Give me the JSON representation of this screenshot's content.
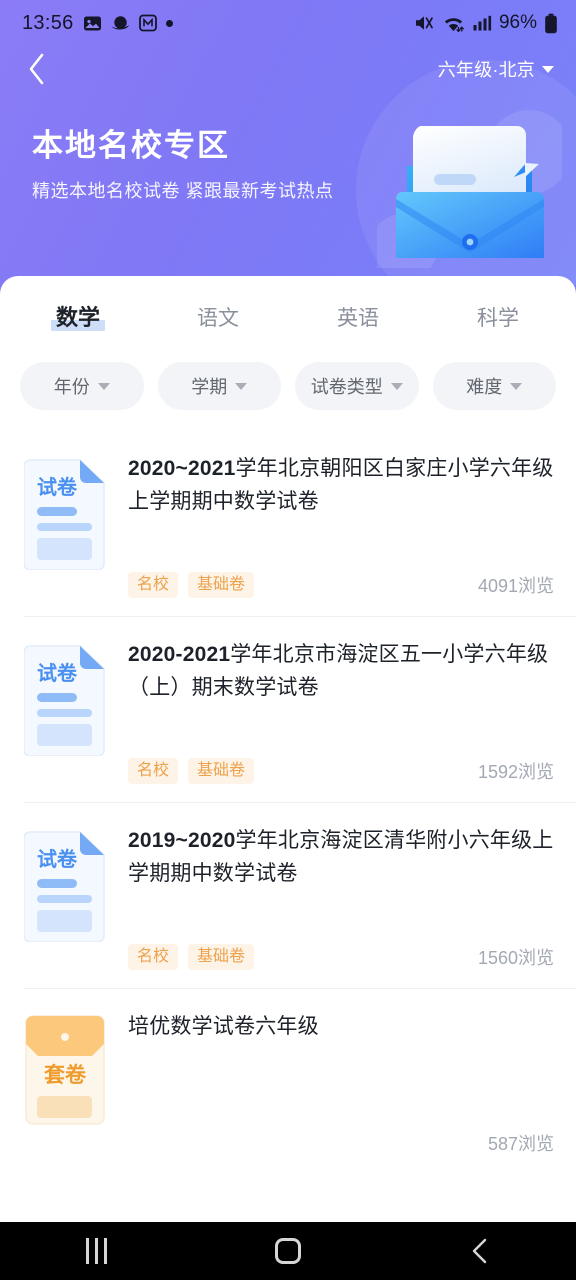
{
  "status_bar": {
    "time": "13:56",
    "battery_percent": "96%",
    "icons": [
      "image-icon",
      "planet-icon",
      "boxed-m-icon",
      "dot-icon",
      "mute-icon",
      "wifi-icon",
      "signal-icon",
      "battery-icon"
    ]
  },
  "header": {
    "back_icon": "chevron-left-icon",
    "grade_region": "六年级·北京",
    "grade_caret": "caret-down-icon",
    "title": "本地名校专区",
    "subtitle": "精选本地名校试卷 紧跟最新考试热点",
    "illustration": "envelope-document-illustration",
    "gradient_from": "#8b7cf6",
    "gradient_to": "#7a84f8"
  },
  "tabs": [
    {
      "label": "数学",
      "active": true
    },
    {
      "label": "语文",
      "active": false
    },
    {
      "label": "英语",
      "active": false
    },
    {
      "label": "科学",
      "active": false
    }
  ],
  "filters": [
    {
      "label": "年份"
    },
    {
      "label": "学期"
    },
    {
      "label": "试卷类型"
    },
    {
      "label": "难度"
    }
  ],
  "list": [
    {
      "icon": "exam-paper-icon",
      "icon_label": "试卷",
      "icon_color": "#3d8bf7",
      "title_bold": "2020~2021",
      "title_rest": "学年北京朝阳区白家庄小学六年级上学期期中数学试卷",
      "tags": [
        "名校",
        "基础卷"
      ],
      "views": "4091浏览"
    },
    {
      "icon": "exam-paper-icon",
      "icon_label": "试卷",
      "icon_color": "#3d8bf7",
      "title_bold": "2020-2021",
      "title_rest": "学年北京市海淀区五一小学六年级（上）期末数学试卷",
      "tags": [
        "名校",
        "基础卷"
      ],
      "views": "1592浏览"
    },
    {
      "icon": "exam-paper-icon",
      "icon_label": "试卷",
      "icon_color": "#3d8bf7",
      "title_bold": "2019~2020",
      "title_rest": "学年北京海淀区清华附小六年级上学期期中数学试卷",
      "tags": [
        "名校",
        "基础卷"
      ],
      "views": "1560浏览"
    },
    {
      "icon": "exam-bundle-icon",
      "icon_label": "套卷",
      "icon_color": "#f0a33c",
      "title_bold": "",
      "title_rest": "培优数学试卷六年级",
      "tags": [],
      "views": "587浏览"
    }
  ],
  "system_nav": {
    "recents": "recents-icon",
    "home": "home-icon",
    "back": "back-icon"
  },
  "colors": {
    "accent_purple": "#7f7bf7",
    "tag_orange": "#eda24c",
    "tab_highlight": "#c5d7f7"
  }
}
